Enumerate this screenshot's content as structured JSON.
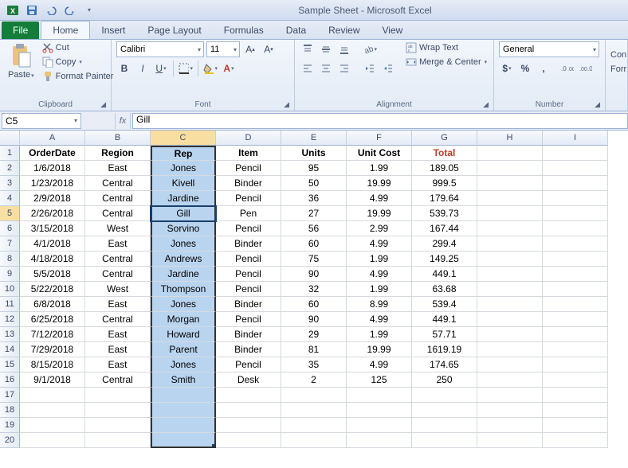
{
  "title": "Sample Sheet  -  Microsoft Excel",
  "tabs": {
    "file": "File",
    "home": "Home",
    "insert": "Insert",
    "page_layout": "Page Layout",
    "formulas": "Formulas",
    "data": "Data",
    "review": "Review",
    "view": "View"
  },
  "ribbon": {
    "clipboard": {
      "paste": "Paste",
      "cut": "Cut",
      "copy": "Copy",
      "format_painter": "Format Painter",
      "label": "Clipboard"
    },
    "font": {
      "name": "Calibri",
      "size": "11",
      "label": "Font"
    },
    "alignment": {
      "wrap": "Wrap Text",
      "merge": "Merge & Center",
      "label": "Alignment"
    },
    "number": {
      "format": "General",
      "label": "Number"
    },
    "cells": {
      "con": "Con",
      "for": "Forr"
    }
  },
  "namebox": "C5",
  "formula": "Gill",
  "col_letters": [
    "A",
    "B",
    "C",
    "D",
    "E",
    "F",
    "G",
    "H",
    "I"
  ],
  "headers": [
    "OrderDate",
    "Region",
    "Rep",
    "Item",
    "Units",
    "Unit Cost",
    "Total"
  ],
  "rows": [
    [
      "1/6/2018",
      "East",
      "Jones",
      "Pencil",
      "95",
      "1.99",
      "189.05"
    ],
    [
      "1/23/2018",
      "Central",
      "Kivell",
      "Binder",
      "50",
      "19.99",
      "999.5"
    ],
    [
      "2/9/2018",
      "Central",
      "Jardine",
      "Pencil",
      "36",
      "4.99",
      "179.64"
    ],
    [
      "2/26/2018",
      "Central",
      "Gill",
      "Pen",
      "27",
      "19.99",
      "539.73"
    ],
    [
      "3/15/2018",
      "West",
      "Sorvino",
      "Pencil",
      "56",
      "2.99",
      "167.44"
    ],
    [
      "4/1/2018",
      "East",
      "Jones",
      "Binder",
      "60",
      "4.99",
      "299.4"
    ],
    [
      "4/18/2018",
      "Central",
      "Andrews",
      "Pencil",
      "75",
      "1.99",
      "149.25"
    ],
    [
      "5/5/2018",
      "Central",
      "Jardine",
      "Pencil",
      "90",
      "4.99",
      "449.1"
    ],
    [
      "5/22/2018",
      "West",
      "Thompson",
      "Pencil",
      "32",
      "1.99",
      "63.68"
    ],
    [
      "6/8/2018",
      "East",
      "Jones",
      "Binder",
      "60",
      "8.99",
      "539.4"
    ],
    [
      "6/25/2018",
      "Central",
      "Morgan",
      "Pencil",
      "90",
      "4.99",
      "449.1"
    ],
    [
      "7/12/2018",
      "East",
      "Howard",
      "Binder",
      "29",
      "1.99",
      "57.71"
    ],
    [
      "7/29/2018",
      "East",
      "Parent",
      "Binder",
      "81",
      "19.99",
      "1619.19"
    ],
    [
      "8/15/2018",
      "East",
      "Jones",
      "Pencil",
      "35",
      "4.99",
      "174.65"
    ],
    [
      "9/1/2018",
      "Central",
      "Smith",
      "Desk",
      "2",
      "125",
      "250"
    ]
  ],
  "total_rows": 20,
  "selected_col": 2,
  "active_cell": {
    "r": 5,
    "c": 2
  },
  "chart_data": {
    "type": "table",
    "columns": [
      "OrderDate",
      "Region",
      "Rep",
      "Item",
      "Units",
      "Unit Cost",
      "Total"
    ],
    "data": [
      [
        "1/6/2018",
        "East",
        "Jones",
        "Pencil",
        95,
        1.99,
        189.05
      ],
      [
        "1/23/2018",
        "Central",
        "Kivell",
        "Binder",
        50,
        19.99,
        999.5
      ],
      [
        "2/9/2018",
        "Central",
        "Jardine",
        "Pencil",
        36,
        4.99,
        179.64
      ],
      [
        "2/26/2018",
        "Central",
        "Gill",
        "Pen",
        27,
        19.99,
        539.73
      ],
      [
        "3/15/2018",
        "West",
        "Sorvino",
        "Pencil",
        56,
        2.99,
        167.44
      ],
      [
        "4/1/2018",
        "East",
        "Jones",
        "Binder",
        60,
        4.99,
        299.4
      ],
      [
        "4/18/2018",
        "Central",
        "Andrews",
        "Pencil",
        75,
        1.99,
        149.25
      ],
      [
        "5/5/2018",
        "Central",
        "Jardine",
        "Pencil",
        90,
        4.99,
        449.1
      ],
      [
        "5/22/2018",
        "West",
        "Thompson",
        "Pencil",
        32,
        1.99,
        63.68
      ],
      [
        "6/8/2018",
        "East",
        "Jones",
        "Binder",
        60,
        8.99,
        539.4
      ],
      [
        "6/25/2018",
        "Central",
        "Morgan",
        "Pencil",
        90,
        4.99,
        449.1
      ],
      [
        "7/12/2018",
        "East",
        "Howard",
        "Binder",
        29,
        1.99,
        57.71
      ],
      [
        "7/29/2018",
        "East",
        "Parent",
        "Binder",
        81,
        19.99,
        1619.19
      ],
      [
        "8/15/2018",
        "East",
        "Jones",
        "Pencil",
        35,
        4.99,
        174.65
      ],
      [
        "9/1/2018",
        "Central",
        "Smith",
        "Desk",
        2,
        125,
        250
      ]
    ]
  }
}
